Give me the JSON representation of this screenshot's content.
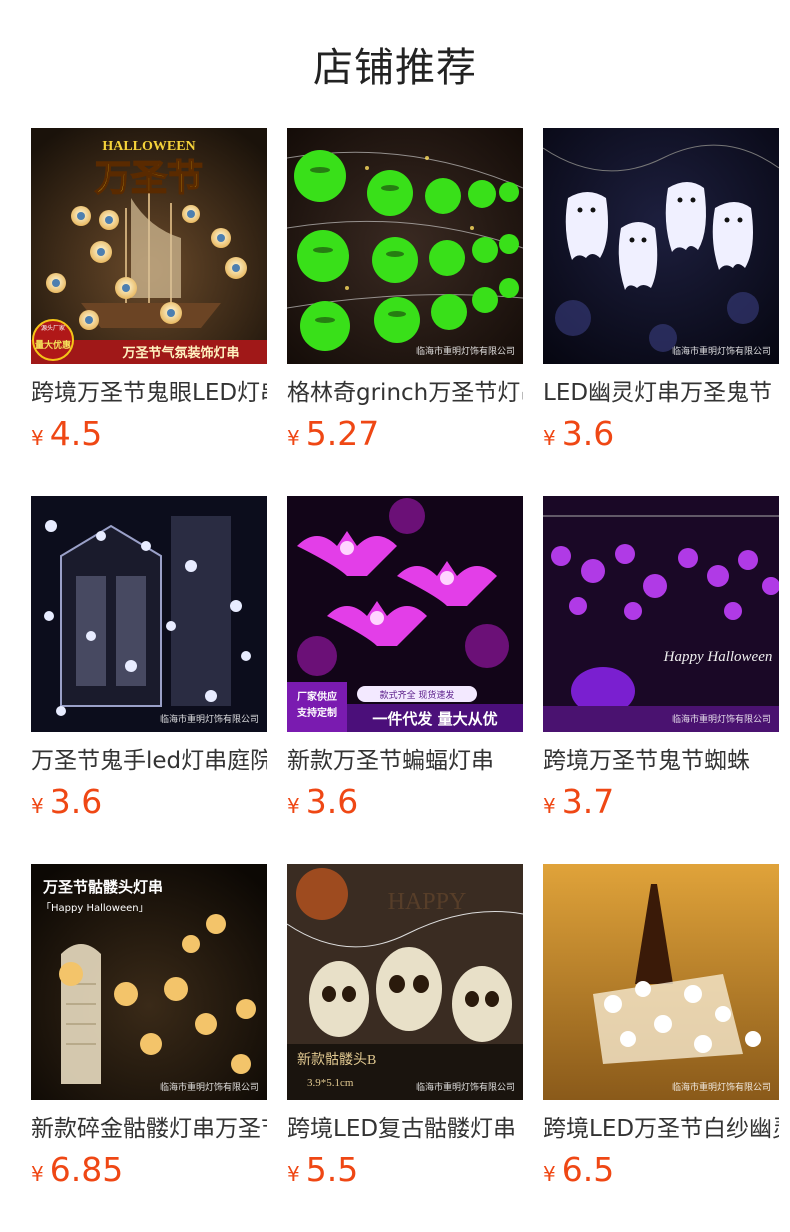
{
  "page_title": "店铺推荐",
  "currency_symbol": "¥",
  "products": [
    {
      "name": "跨境万圣节鬼眼LED灯串",
      "price": "4.5",
      "image": {
        "kind": "eyeball-ship",
        "headline": "HALLOWEEN",
        "big_text": "万圣节",
        "badge_top": "源头厂家",
        "badge_main": "量大优惠",
        "bottom_text": "万圣节气氛装饰灯串"
      }
    },
    {
      "name": "格林奇grinch万圣节灯串",
      "price": "5.27",
      "image": {
        "kind": "green-grinch",
        "watermark": "临海市重明灯饰有限公司"
      }
    },
    {
      "name": "LED幽灵灯串万圣鬼节",
      "price": "3.6",
      "image": {
        "kind": "white-ghost",
        "watermark": "临海市重明灯饰有限公司"
      }
    },
    {
      "name": "万圣节鬼手led灯串庭院",
      "price": "3.6",
      "image": {
        "kind": "ghost-hand",
        "watermark": "临海市重明灯饰有限公司"
      }
    },
    {
      "name": "新款万圣节蝙蝠灯串",
      "price": "3.6",
      "image": {
        "kind": "purple-bat",
        "tag_left": "厂家供应 支持定制",
        "tag_top": "款式齐全 现货速发",
        "tag_main": "一件代发 量大从优"
      }
    },
    {
      "name": "跨境万圣节鬼节蜘蛛",
      "price": "3.7",
      "image": {
        "kind": "purple-spider",
        "script_text": "Happy Halloween",
        "watermark": "临海市重明灯饰有限公司"
      }
    },
    {
      "name": "新款碎金骷髅灯串万圣节",
      "price": "6.85",
      "image": {
        "kind": "gold-skull",
        "headline": "万圣节骷髅头灯串",
        "subline": "「Happy Halloween」",
        "watermark": "临海市重明灯饰有限公司"
      }
    },
    {
      "name": "跨境LED复古骷髅灯串",
      "price": "5.5",
      "image": {
        "kind": "vintage-skull",
        "caption": "新款骷髅头B",
        "size": "3.9*5.1cm",
        "watermark": "临海市重明灯饰有限公司"
      }
    },
    {
      "name": "跨境LED万圣节白纱幽灵",
      "price": "6.5",
      "image": {
        "kind": "tulle-ghost",
        "watermark": "临海市重明灯饰有限公司"
      }
    }
  ],
  "colors": {
    "price": "#ef4714",
    "title": "#222222",
    "name": "#333333"
  }
}
